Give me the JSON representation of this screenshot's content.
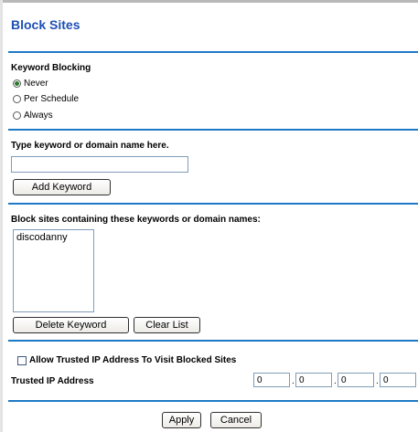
{
  "page": {
    "title": "Block Sites"
  },
  "keyword_blocking": {
    "label": "Keyword Blocking",
    "options": [
      {
        "label": "Never",
        "selected": true
      },
      {
        "label": "Per Schedule",
        "selected": false
      },
      {
        "label": "Always",
        "selected": false
      }
    ]
  },
  "keyword_entry": {
    "label": "Type keyword or domain name here.",
    "value": "",
    "add_button": "Add Keyword"
  },
  "blocked_list": {
    "label": "Block sites containing these keywords or domain names:",
    "items": [
      "discodanny"
    ],
    "delete_button": "Delete Keyword",
    "clear_button": "Clear List"
  },
  "trusted": {
    "checkbox_label": "Allow Trusted IP Address To Visit Blocked Sites",
    "checked": false,
    "ip_label": "Trusted IP Address",
    "ip": [
      "0",
      "0",
      "0",
      "0"
    ],
    "separator": "."
  },
  "footer": {
    "apply": "Apply",
    "cancel": "Cancel"
  },
  "colors": {
    "title": "#1d4fb4",
    "rule": "#1e79c6",
    "selected_radio": "#2a7a2a"
  }
}
